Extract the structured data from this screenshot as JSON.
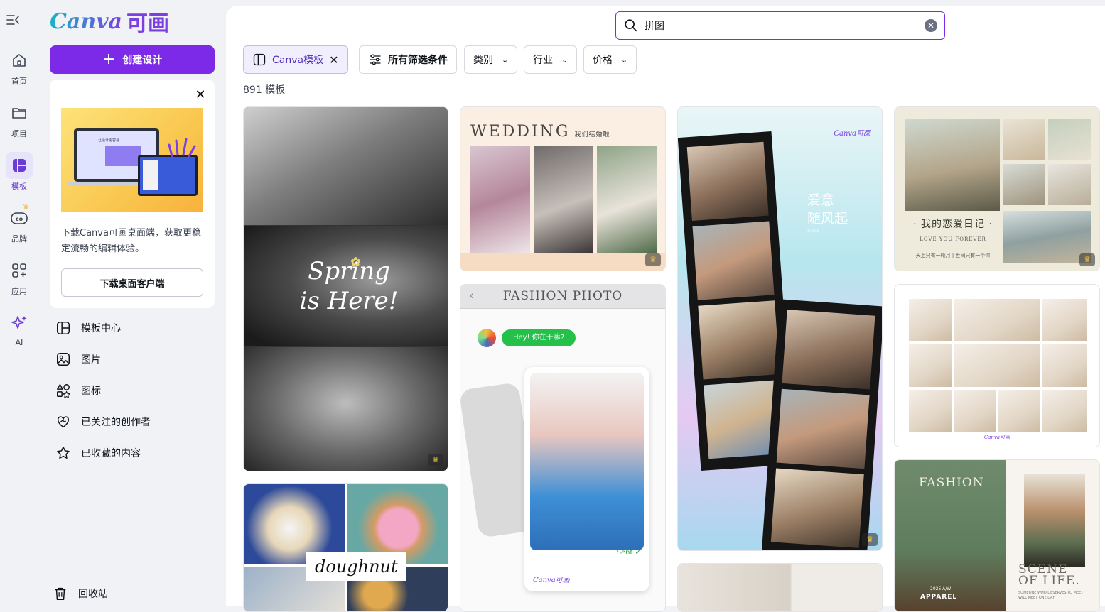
{
  "rail": {
    "items": [
      {
        "label": "首页",
        "icon": "home-icon"
      },
      {
        "label": "项目",
        "icon": "folder-icon"
      },
      {
        "label": "模板",
        "icon": "template-icon",
        "active": true
      },
      {
        "label": "品牌",
        "icon": "brand-icon"
      },
      {
        "label": "应用",
        "icon": "apps-icon"
      },
      {
        "label": "AI",
        "icon": "sparkle-icon"
      }
    ]
  },
  "panel": {
    "logo_text": "Canva",
    "logo_cn": "可画",
    "create_label": "创建设计",
    "promo": {
      "text": "下载Canva可画桌面端，获取更稳定流畅的编辑体验。",
      "button": "下载桌面客户端",
      "mock_text": "让设计更容易"
    },
    "nav": [
      {
        "label": "模板中心",
        "icon": "template-center-icon"
      },
      {
        "label": "图片",
        "icon": "image-icon"
      },
      {
        "label": "图标",
        "icon": "shapes-icon"
      },
      {
        "label": "已关注的创作者",
        "icon": "heart-handshake-icon"
      },
      {
        "label": "已收藏的内容",
        "icon": "star-icon"
      }
    ],
    "trash": {
      "label": "回收站",
      "icon": "trash-icon"
    }
  },
  "search": {
    "value": "拼图"
  },
  "filters": {
    "selected": "Canva模板",
    "all": "所有筛选条件",
    "category": "类别",
    "industry": "行业",
    "price": "价格"
  },
  "results": {
    "count": "891 模板"
  },
  "cards": {
    "spring": {
      "line1": "Spring",
      "line2": "is Here!"
    },
    "wedding": {
      "title": "WEDDING",
      "sub": "我们结婚啦"
    },
    "fashion_photo": {
      "title": "FASHION PHOTO",
      "bubble": "Hey! 你在干嘛?",
      "sent": "Sent ✓",
      "brand": "Canva可画"
    },
    "doughnut": {
      "label": "doughnut"
    },
    "film": {
      "brand": "Canva可画",
      "zh1": "爱意",
      "zh2": "随风起",
      "small": "LOVE"
    },
    "diary": {
      "title": "· 我的恋爱日记 ·",
      "en": "LOVE YOU FOREVER",
      "cn": "天上只有一轮月 | 世间只有一个你"
    },
    "jewelry": {
      "brand": "Canva可画"
    },
    "fashion_scene": {
      "title": "FASHION",
      "year": "2025 A/W",
      "apparel": "APPAREL",
      "scene1": "SCENE",
      "scene2": "OF LIFE.",
      "small": "SOMEONE WHO DESERVES TO MEET WILL MEET ONE DAY"
    }
  }
}
